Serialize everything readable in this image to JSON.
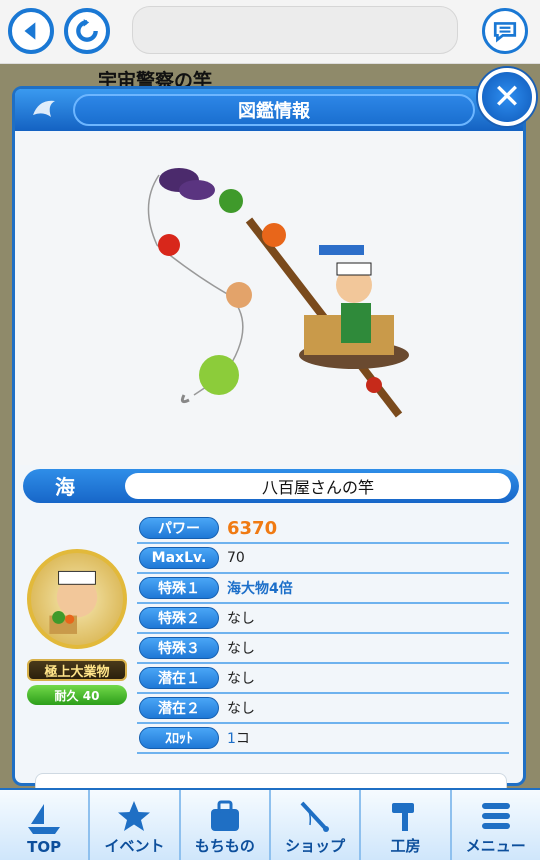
{
  "browser": {
    "back_icon": "back-arrow-icon",
    "reload_icon": "reload-icon",
    "chat_icon": "chat-bubble-icon"
  },
  "background_page": {
    "title": "宇宙警察の竿"
  },
  "modal": {
    "title": "図鑑情報",
    "close_icon": "close-icon",
    "header_icon": "fish-icon",
    "category": "海",
    "rod_name": "八百屋さんの竿",
    "stats": [
      {
        "label": "パワー",
        "value": "6370"
      },
      {
        "label": "MaxLv.",
        "value": "70"
      },
      {
        "label": "特殊１",
        "value": "海大物4倍"
      },
      {
        "label": "特殊２",
        "value": "なし"
      },
      {
        "label": "特殊３",
        "value": "なし"
      },
      {
        "label": "潜在１",
        "value": "なし"
      },
      {
        "label": "潜在２",
        "value": "なし"
      },
      {
        "label": "ｽﾛｯﾄ",
        "value_num": "1",
        "value_unit": "コ"
      }
    ],
    "rank": "極上大業物",
    "durability": "耐久 40"
  },
  "nav": [
    {
      "label": "TOP",
      "icon": "boat-icon"
    },
    {
      "label": "イベント",
      "icon": "star-icon"
    },
    {
      "label": "もちもの",
      "icon": "bag-icon"
    },
    {
      "label": "ショップ",
      "icon": "fishing-rod-icon"
    },
    {
      "label": "工房",
      "icon": "hammer-icon"
    },
    {
      "label": "メニュー",
      "icon": "menu-icon"
    }
  ],
  "colors": {
    "accent_blue": "#1f6fc4",
    "power_orange": "#f07a12",
    "special_blue": "#1d6fc9"
  }
}
